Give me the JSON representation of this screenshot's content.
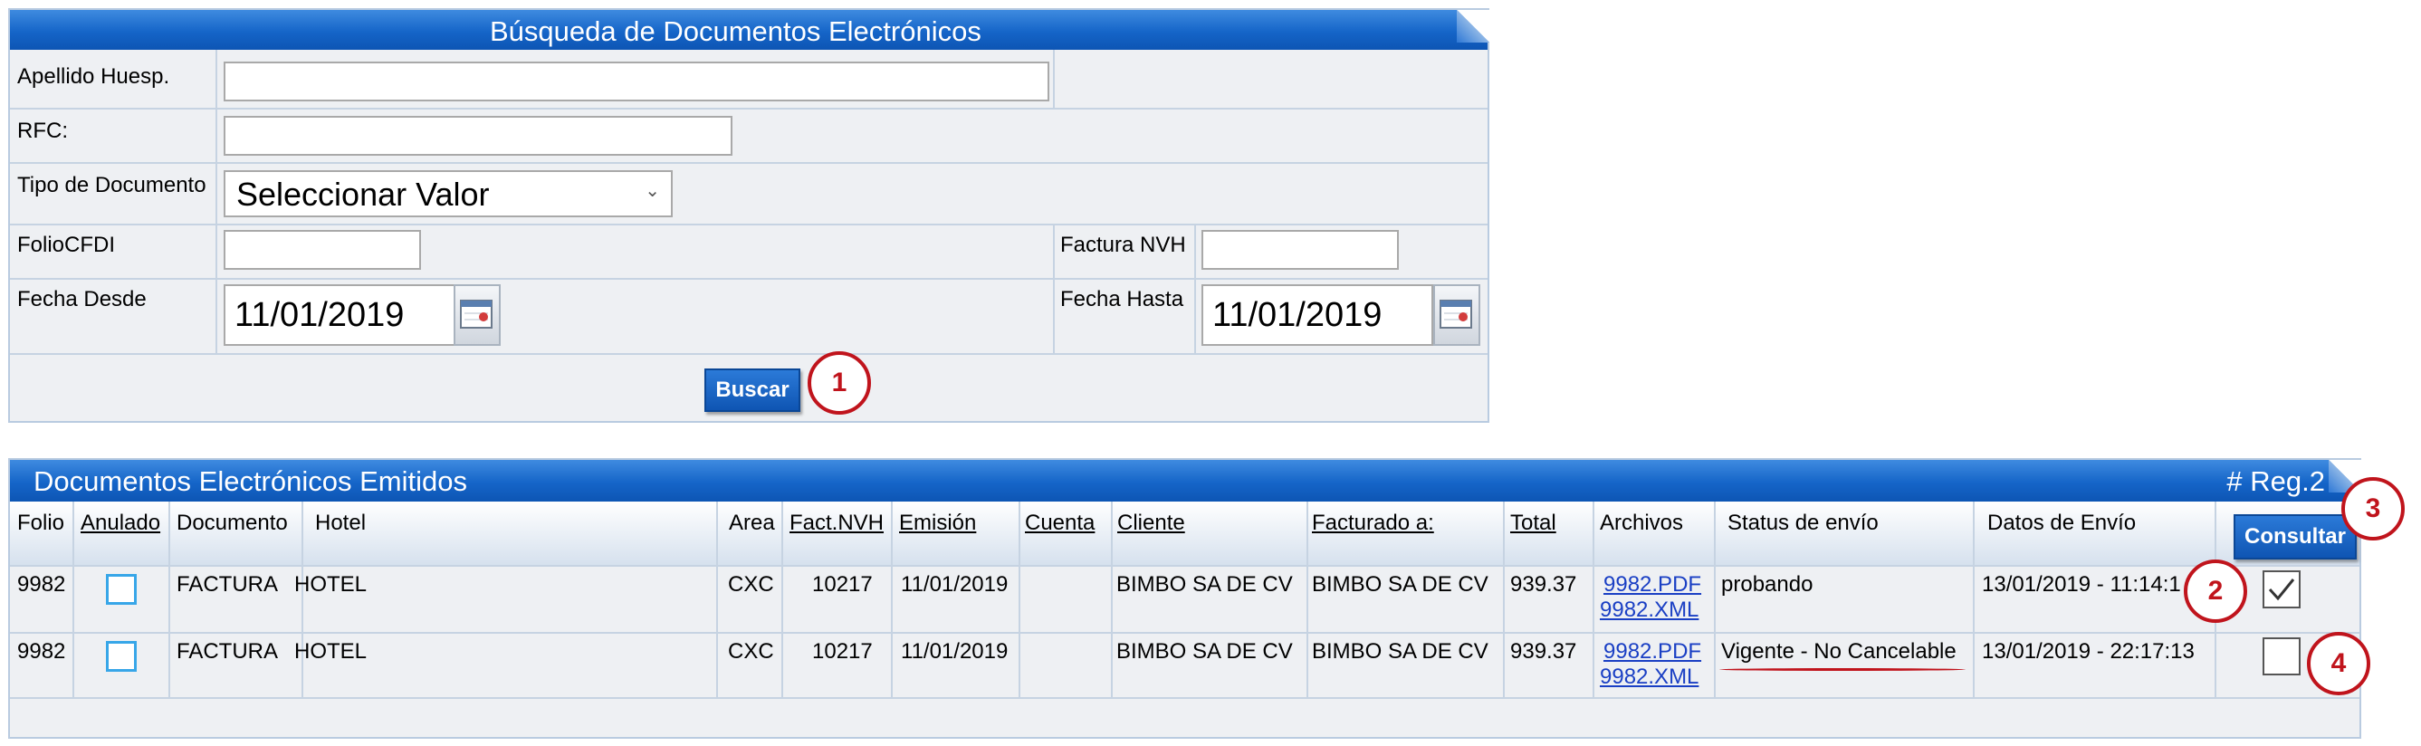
{
  "search": {
    "title": "Búsqueda de Documentos Electrónicos",
    "apellido_label": "Apellido Huesp.",
    "apellido_value": "",
    "rfc_label": "RFC:",
    "rfc_value": "",
    "tipo_label": "Tipo de Documento",
    "tipo_selected": "Seleccionar Valor",
    "folio_label": "FolioCFDI",
    "folio_value": "",
    "factura_label": "Factura NVH",
    "factura_value": "",
    "desde_label": "Fecha Desde",
    "desde_value": "11/01/2019",
    "hasta_label": "Fecha Hasta",
    "hasta_value": "11/01/2019",
    "buscar_label": "Buscar"
  },
  "results": {
    "title": "Documentos Electrónicos Emitidos",
    "count_label": "# Reg.2",
    "consultar_label": "Consultar",
    "columns": [
      "Folio",
      "Anulado",
      "Documento",
      "Hotel",
      "Area",
      "Fact.NVH",
      "Emisión",
      "Cuenta",
      "Cliente",
      "Facturado a:",
      "Total",
      "Archivos",
      "Status de envío",
      "Datos de Envío"
    ],
    "rows": [
      {
        "folio": "9982",
        "documento": "FACTURA",
        "hotel": "HOTEL",
        "area": "CXC",
        "fact": "10217",
        "emision": "11/01/2019",
        "cuenta": "",
        "cliente": "BIMBO SA DE CV",
        "facturado": "BIMBO SA DE CV",
        "total": "939.37",
        "pdf": "9982.PDF",
        "xml": "9982.XML",
        "status": "probando",
        "datos": "13/01/2019 - 11:14:1"
      },
      {
        "folio": "9982",
        "documento": "FACTURA",
        "hotel": "HOTEL",
        "area": "CXC",
        "fact": "10217",
        "emision": "11/01/2019",
        "cuenta": "",
        "cliente": "BIMBO SA DE CV",
        "facturado": "BIMBO SA DE CV",
        "total": "939.37",
        "pdf": "9982.PDF",
        "xml": "9982.XML",
        "status": "Vigente - No Cancelable",
        "datos": "13/01/2019 - 22:17:13"
      }
    ]
  },
  "annotations": {
    "n1": "1",
    "n2": "2",
    "n3": "3",
    "n4": "4"
  },
  "colors": {
    "header": "#1565c8",
    "annotation": "#c0141c",
    "border": "#b9cbe0"
  }
}
